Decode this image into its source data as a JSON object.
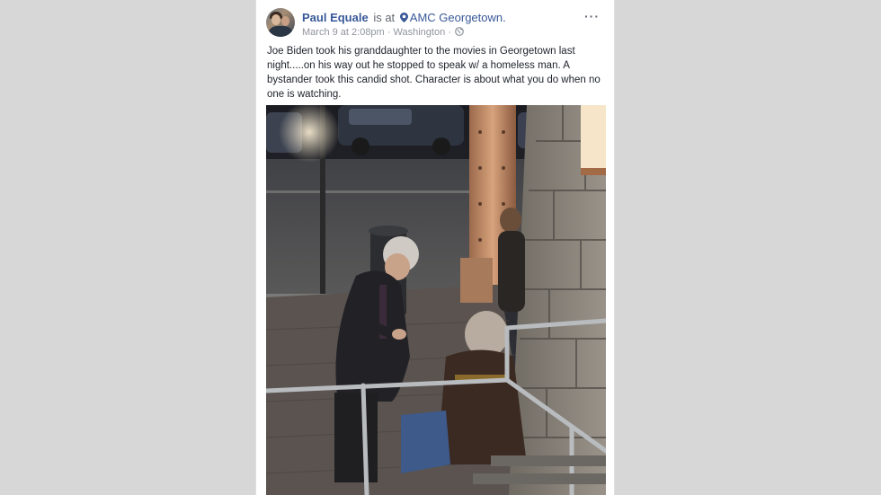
{
  "post": {
    "author": "Paul Equale",
    "is_at": "is at",
    "location": "AMC Georgetown.",
    "timestamp": "March 9 at 2:08pm",
    "place": "Washington",
    "separator": "·",
    "more": "···",
    "text": "Joe Biden took his granddaughter to the movies in Georgetown last night.....on his way out he stopped to speak w/ a homeless man. A bystander took this candid shot. Character is about what you do when no one is watching."
  },
  "colors": {
    "link": "#385898",
    "meta": "#90949c",
    "text": "#1d2129"
  },
  "icons": {
    "avatar": "profile-photo",
    "location": "map-pin-icon",
    "privacy": "globe-icon",
    "menu": "more-options-icon"
  }
}
